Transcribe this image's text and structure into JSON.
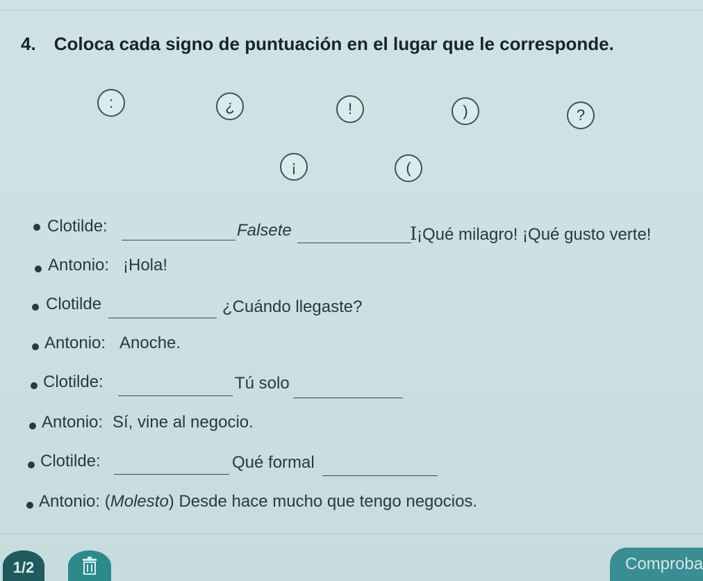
{
  "exercise": {
    "number": "4.",
    "instruction": "Coloca cada signo de puntuación en el lugar que le corresponde."
  },
  "symbols": [
    ":",
    "¿",
    "!",
    ")",
    "?",
    "¡",
    "("
  ],
  "dialogue": [
    {
      "speaker": "Clotilde:",
      "text1": "Falsete",
      "text2": "¡Qué milagro! ¡Qué gusto verte!"
    },
    {
      "speaker": "Antonio:",
      "text": "¡Hola!"
    },
    {
      "speaker": "Clotilde",
      "text": "¿Cuándo llegaste?"
    },
    {
      "speaker": "Antonio:",
      "text": "Anoche."
    },
    {
      "speaker": "Clotilde:",
      "text": "Tú solo"
    },
    {
      "speaker": "Antonio:",
      "text": "Sí, vine al negocio."
    },
    {
      "speaker": "Clotilde:",
      "text": "Qué formal"
    },
    {
      "speaker": "Antonio:",
      "text_italic": "Molesto",
      "text": "Desde hace mucho que tengo negocios."
    }
  ],
  "footer": {
    "page": "1/2",
    "trash_icon": "trash-icon",
    "check_label": "Comprobar"
  }
}
